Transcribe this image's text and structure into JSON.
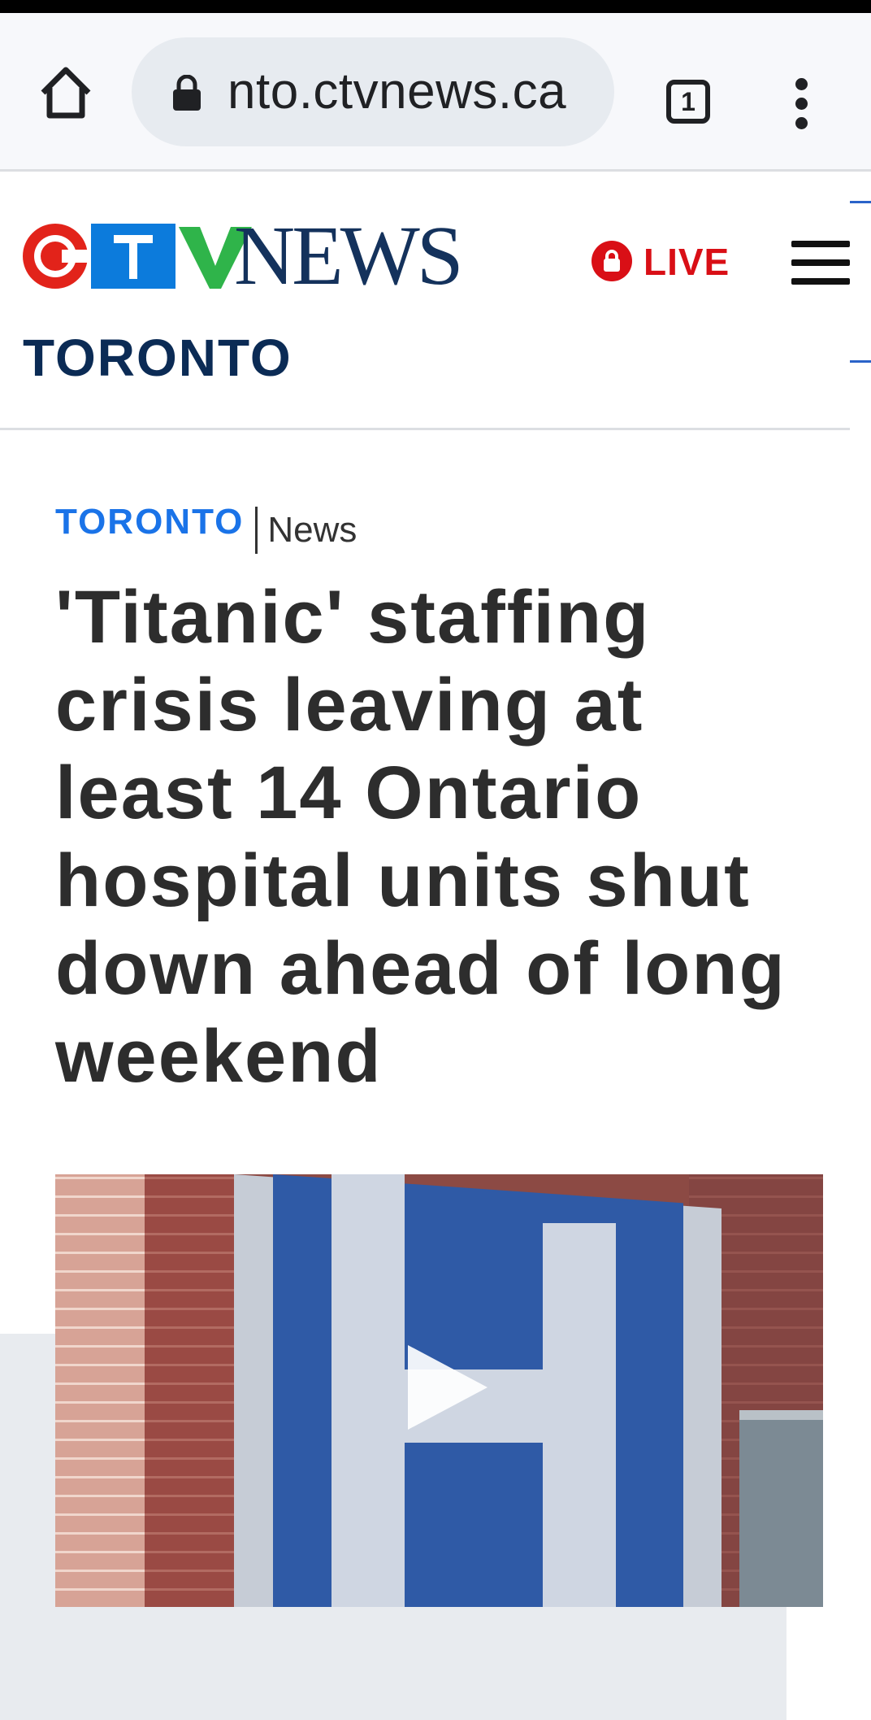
{
  "browser": {
    "url": "nto.ctvnews.ca",
    "tab_count": "1",
    "icons": [
      "home-icon",
      "lock-icon",
      "tabs-icon",
      "more-vert-icon"
    ]
  },
  "header": {
    "logo_letters": [
      "C",
      "T",
      "V"
    ],
    "logo_word": "NEWS",
    "city": "TORONTO",
    "live_label": "LIVE",
    "colors": {
      "brand_red": "#e2231a",
      "brand_blue": "#0c7bdc",
      "brand_green": "#2fb44a",
      "navy": "#14325c",
      "live_red": "#d90f16"
    }
  },
  "article": {
    "section_city": "TORONTO",
    "section_category": "News",
    "headline": "'Titanic' staffing crisis leaving at least 14 Ontario hospital units shut down ahead of long weekend",
    "video_icon": "play-icon"
  }
}
